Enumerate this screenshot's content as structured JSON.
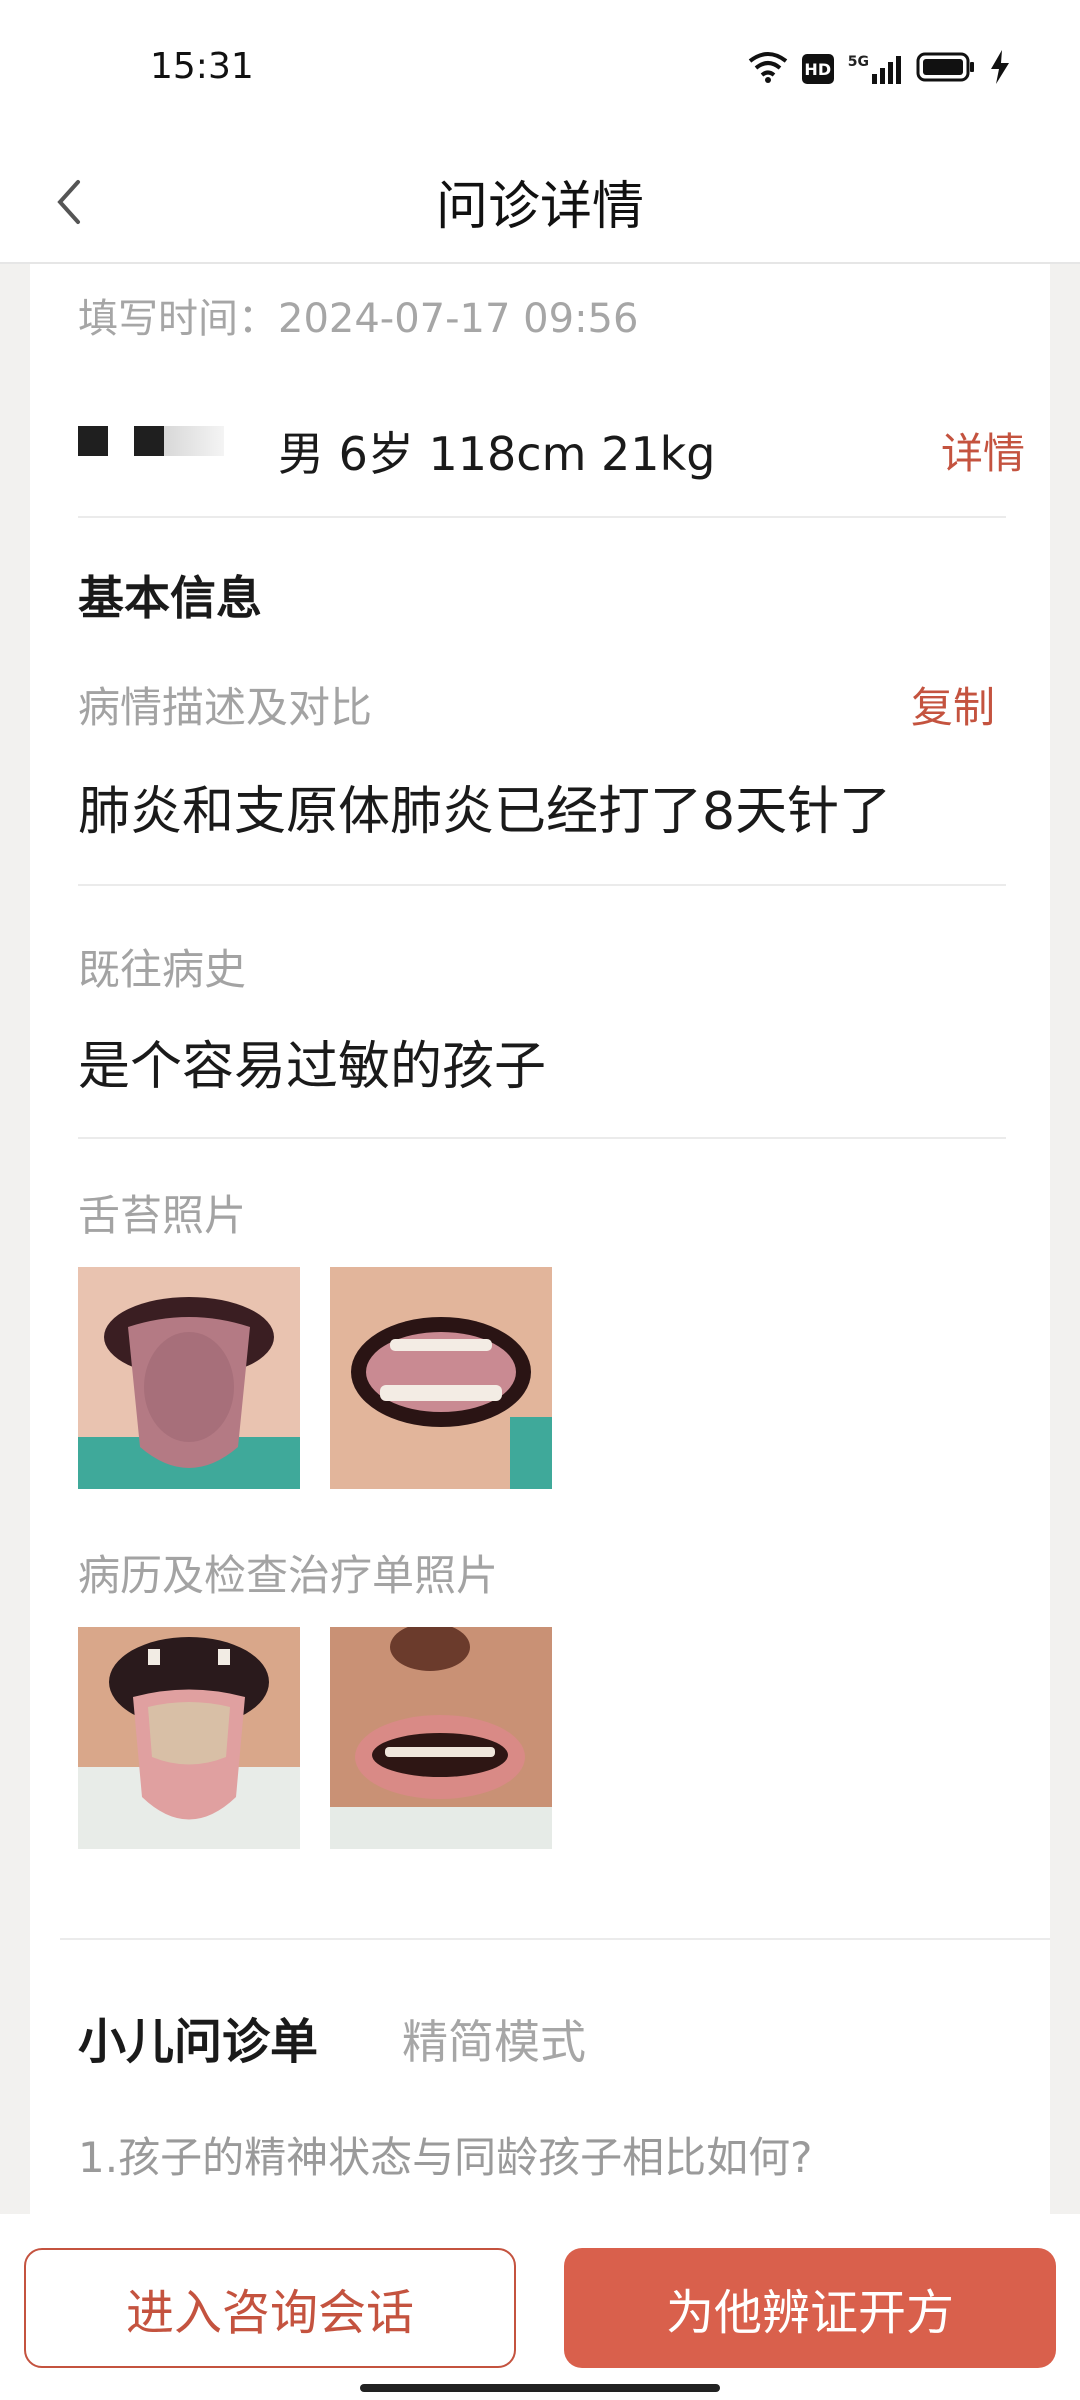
{
  "status_bar": {
    "time": "15:31",
    "icons": [
      "wifi-icon",
      "hd-icon",
      "signal-5g-icon",
      "battery-icon",
      "charging-icon"
    ],
    "network_badge": "HD",
    "network_type": "5G"
  },
  "nav": {
    "title": "问诊详情",
    "back_icon": "back-icon"
  },
  "record": {
    "fill_time": "填写时间：2024-07-17 09:56",
    "patient_info": "男 6岁 118cm 21kg",
    "detail_link": "详情"
  },
  "basic_info": {
    "title": "基本信息",
    "description_label": "病情描述及对比",
    "copy_link": "复制",
    "description_value": "肺炎和支原体肺炎已经打了8天针了",
    "history_label": "既往病史",
    "history_value": "是个容易过敏的孩子",
    "tongue_photos_label": "舌苔照片",
    "record_photos_label": "病历及检查治疗单照片"
  },
  "questionnaire": {
    "title": "小儿问诊单",
    "mode": "精简模式",
    "question_1": "1.孩子的精神状态与同龄孩子相比如何?"
  },
  "actions": {
    "enter_chat": "进入咨询会话",
    "prescribe": "为他辨证开方"
  },
  "colors": {
    "accent": "#c4533f",
    "primary_button": "#d9604c",
    "muted_text": "#a3a3a3",
    "background": "#f2f1ef"
  }
}
